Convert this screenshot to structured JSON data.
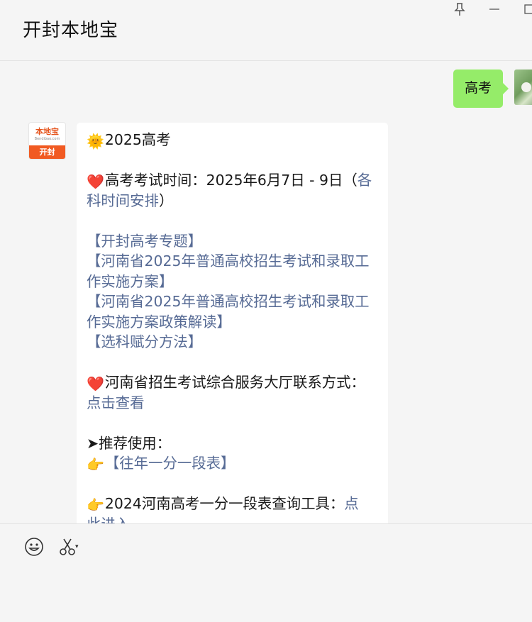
{
  "window": {
    "title": "开封本地宝",
    "pin_icon": "📌",
    "minimize_glyph": "—",
    "maximize_glyph": "□"
  },
  "outgoing": {
    "text": "高考"
  },
  "incoming_avatar": {
    "logo_top": "本地宝",
    "logo_small": "Bendibao.com",
    "logo_bottom": "开封"
  },
  "message": {
    "sun_emoji": "🌞",
    "heart_emoji": "❤️",
    "hand_emoji": "👉",
    "l1": "2025高考",
    "l2_text": "高考考试时间：2025年6月7日 - 9日（",
    "l2_link": "各科时间安排",
    "l2_close": "）",
    "link_zhuanti": "【开封高考专题】",
    "link_fangan_a": "【河南省2025年普通高校招生考试和录取工",
    "link_fangan_b": "作实施方案】",
    "link_jiedu_a": "【河南省2025年普通高校招生考试和录取工",
    "link_jiedu_b": "作实施方案政策解读】",
    "link_xuanke": "【选科赋分方法】",
    "l_contact": "河南省招生考试综合服务大厅联系方式：",
    "link_check": "点击查看",
    "l_recommend": "➤推荐使用：",
    "link_yfyd_bracket_open": "【",
    "link_yfyd": "往年一分一段表",
    "link_yfyd_bracket_close": "】",
    "l_tool_text": "2024河南高考一分一段表查询工具：",
    "link_tool_a": "点",
    "link_tool_b": "此进入"
  },
  "composer": {
    "emoji_icon": "☺",
    "scissor_icon": "✂",
    "caret": "▾"
  }
}
